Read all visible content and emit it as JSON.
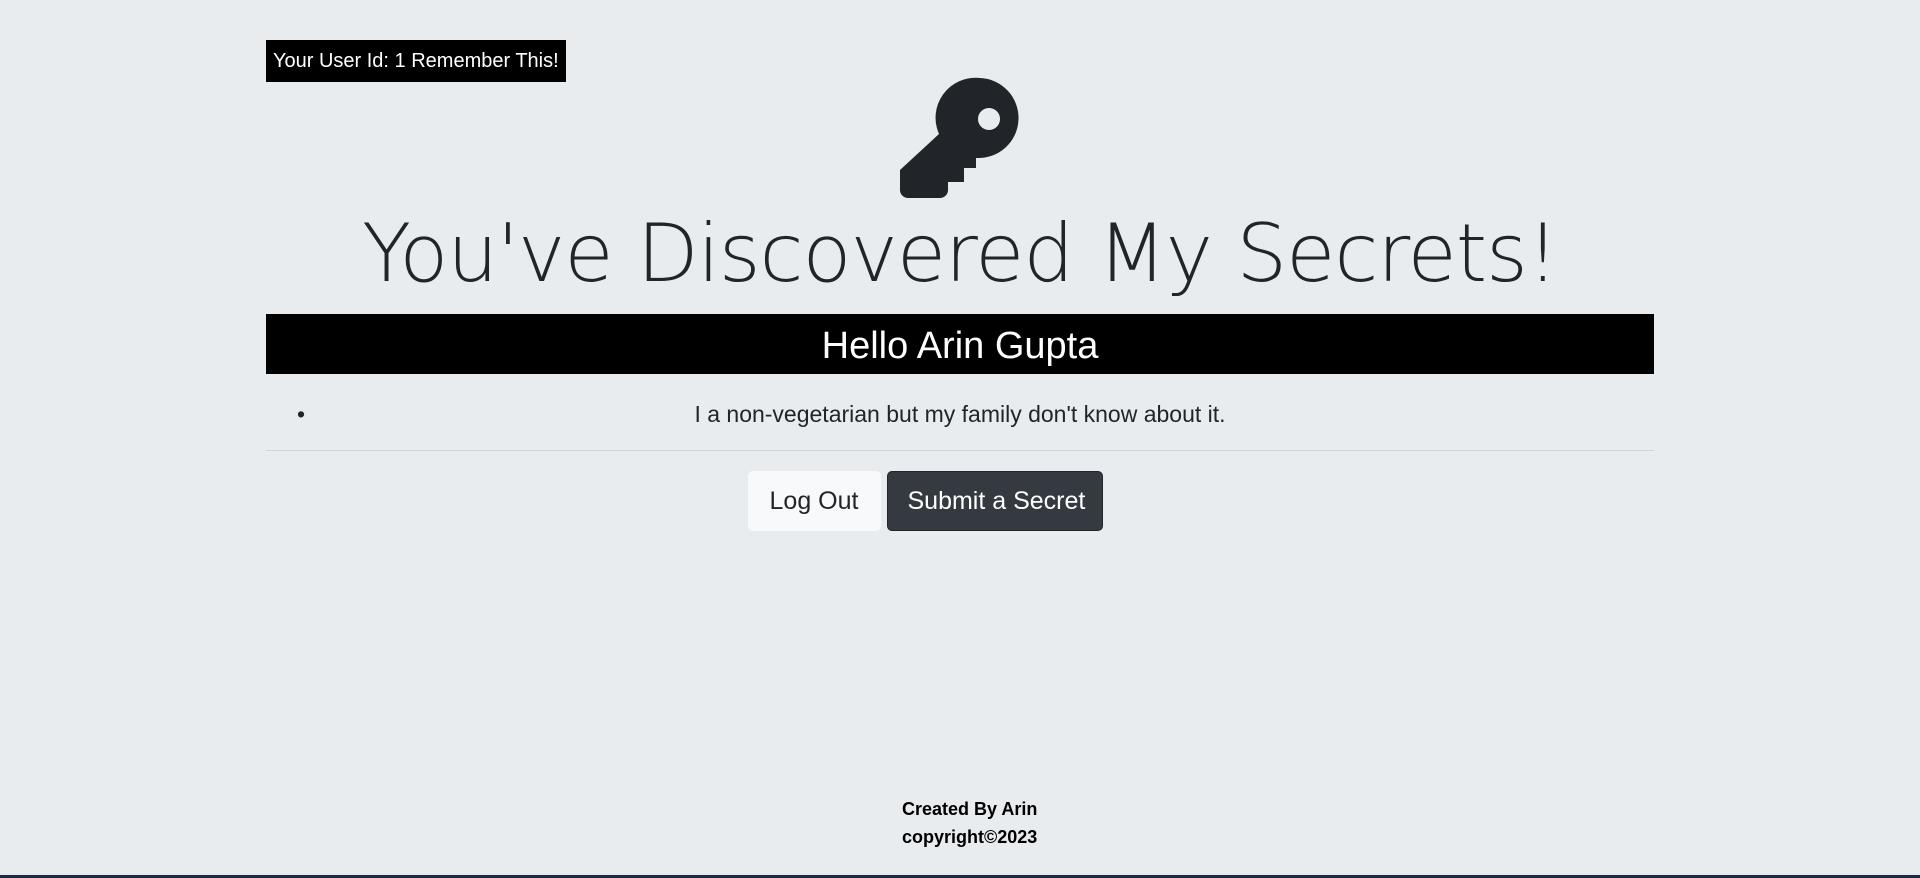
{
  "user_badge": {
    "text": "Your User Id: 1 Remember This!"
  },
  "header": {
    "icon": "key-icon",
    "title": "You've Discovered My Secrets!"
  },
  "greeting": {
    "text": "Hello Arin Gupta"
  },
  "secrets": [
    {
      "bullet": "•",
      "text": "I a non-vegetarian but my family don't know about it."
    }
  ],
  "actions": {
    "logout_label": "Log Out",
    "submit_label": "Submit a Secret"
  },
  "footer": {
    "created_by": "Created By Arin",
    "copyright": "copyright©2023"
  },
  "colors": {
    "background": "#e8ecef",
    "bar": "#000000",
    "button_dark": "#343a40",
    "button_light": "#f8f9fa",
    "text": "#212529"
  }
}
